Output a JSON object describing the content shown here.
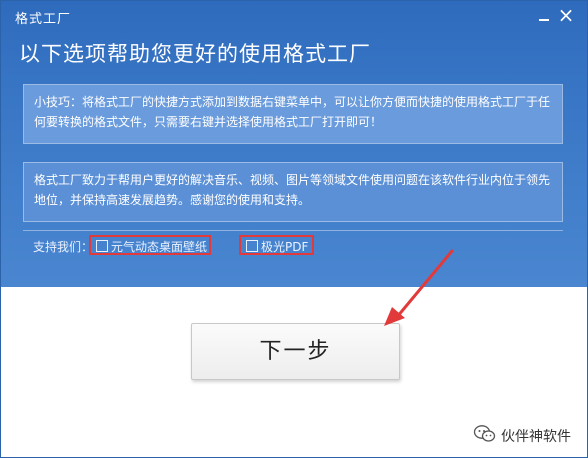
{
  "window": {
    "title": "格式工厂",
    "minimize_label": "",
    "close_label": "×"
  },
  "heading": "以下选项帮助您更好的使用格式工厂",
  "tip_text": "小技巧：将格式工厂的快捷方式添加到数据右键菜单中，可以让你方便而快捷的使用格式工厂于任何要转换的格式文件，只需要右键并选择使用格式工厂打开即可！",
  "description_text": "格式工厂致力于帮用户更好的解决音乐、视频、图片等领域文件使用问题在该软件行业内位于领先地位，并保持高速发展趋势。感谢您的使用和支持。",
  "support": {
    "label": "支持我们：",
    "options": [
      {
        "label": "元气动态桌面壁纸",
        "checked": false
      },
      {
        "label": "极光PDF",
        "checked": false
      }
    ]
  },
  "next_button": "下一步",
  "watermark": "伙伴神软件",
  "colors": {
    "panel": "#3a78c7",
    "highlight": "#e23a3a",
    "arrow": "#e23a3a"
  },
  "icons": [
    "minimize-icon",
    "close-icon",
    "checkbox-icon",
    "arrow-annotation",
    "wechat-icon"
  ]
}
